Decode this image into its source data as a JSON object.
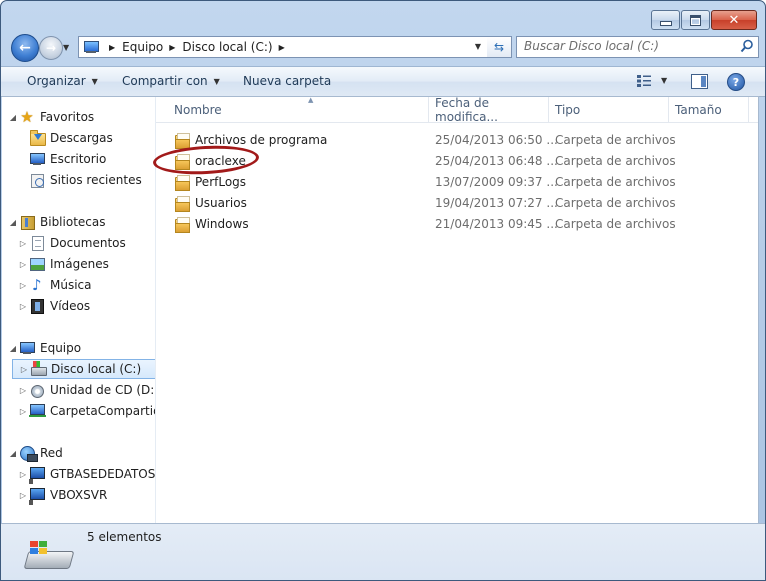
{
  "window": {
    "caption": {
      "minimize": "_",
      "maximize": "□",
      "close": "✕"
    }
  },
  "address_bar": {
    "crumbs": [
      "Equipo",
      "Disco local (C:)"
    ]
  },
  "search": {
    "placeholder": "Buscar Disco local (C:)"
  },
  "toolbar": {
    "organize": "Organizar",
    "share": "Compartir con",
    "new_folder": "Nueva carpeta"
  },
  "nav": {
    "favorites": {
      "label": "Favoritos",
      "items": [
        {
          "label": "Descargas",
          "icon": "downloads-icon"
        },
        {
          "label": "Escritorio",
          "icon": "desktop-icon"
        },
        {
          "label": "Sitios recientes",
          "icon": "recent-places-icon"
        }
      ]
    },
    "libraries": {
      "label": "Bibliotecas",
      "items": [
        {
          "label": "Documentos",
          "icon": "documents-icon"
        },
        {
          "label": "Imágenes",
          "icon": "pictures-icon"
        },
        {
          "label": "Música",
          "icon": "music-icon"
        },
        {
          "label": "Vídeos",
          "icon": "videos-icon"
        }
      ]
    },
    "computer": {
      "label": "Equipo",
      "items": [
        {
          "label": "Disco local (C:)",
          "icon": "local-disk-icon",
          "selected": true
        },
        {
          "label": "Unidad de CD (D:)",
          "icon": "cd-drive-icon"
        },
        {
          "label": "CarpetaCompartida",
          "icon": "shared-folder-icon"
        }
      ]
    },
    "network": {
      "label": "Red",
      "items": [
        {
          "label": "GTBASEDEDATOS",
          "icon": "network-computer-icon"
        },
        {
          "label": "VBOXSVR",
          "icon": "network-computer-icon"
        }
      ]
    }
  },
  "columns": {
    "name": "Nombre",
    "date": "Fecha de modifica...",
    "type": "Tipo",
    "size": "Tamaño"
  },
  "files": [
    {
      "name": "Archivos de programa",
      "date": "25/04/2013 06:50 ...",
      "type": "Carpeta de archivos"
    },
    {
      "name": "oraclexe",
      "date": "25/04/2013 06:48 ...",
      "type": "Carpeta de archivos"
    },
    {
      "name": "PerfLogs",
      "date": "13/07/2009 09:37 ...",
      "type": "Carpeta de archivos"
    },
    {
      "name": "Usuarios",
      "date": "19/04/2013 07:27 ...",
      "type": "Carpeta de archivos"
    },
    {
      "name": "Windows",
      "date": "21/04/2013 09:45 ...",
      "type": "Carpeta de archivos"
    }
  ],
  "status": {
    "count": "5 elementos"
  },
  "colors": {
    "annotation_circle": "#a21a1a",
    "accent": "#2c74c9"
  }
}
